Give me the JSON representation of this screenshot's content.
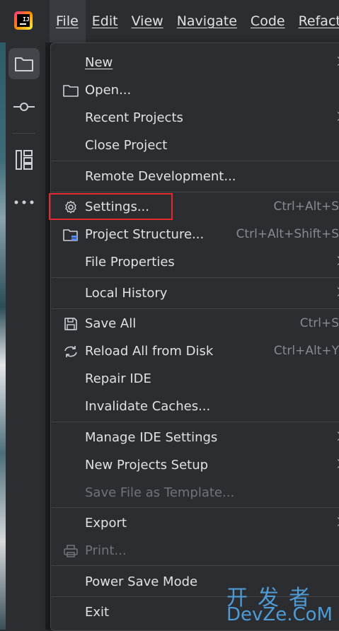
{
  "menu_bar": {
    "items": [
      "File",
      "Edit",
      "View",
      "Navigate",
      "Code",
      "Refactor"
    ]
  },
  "sidebar": {
    "buttons": [
      "folder-icon",
      "commit-icon",
      "structure-icon",
      "more-icon"
    ]
  },
  "file_menu": {
    "new": "New",
    "open": "Open...",
    "recent_projects": "Recent Projects",
    "close_project": "Close Project",
    "remote_development": "Remote Development...",
    "settings": "Settings...",
    "settings_shortcut": "Ctrl+Alt+S",
    "project_structure": "Project Structure...",
    "project_structure_shortcut": "Ctrl+Alt+Shift+S",
    "file_properties": "File Properties",
    "local_history": "Local History",
    "save_all": "Save All",
    "save_all_shortcut": "Ctrl+S",
    "reload_all": "Reload All from Disk",
    "reload_all_shortcut": "Ctrl+Alt+Y",
    "repair_ide": "Repair IDE",
    "invalidate_caches": "Invalidate Caches...",
    "manage_ide_settings": "Manage IDE Settings",
    "new_projects_setup": "New Projects Setup",
    "save_file_as_template": "Save File as Template...",
    "export": "Export",
    "print": "Print...",
    "power_save_mode": "Power Save Mode",
    "exit": "Exit"
  },
  "watermark": {
    "cn": "开发者",
    "en": "DevZe.CoM"
  },
  "colors": {
    "highlight_border": "#e5282c",
    "watermark": "#4e9bd6"
  }
}
